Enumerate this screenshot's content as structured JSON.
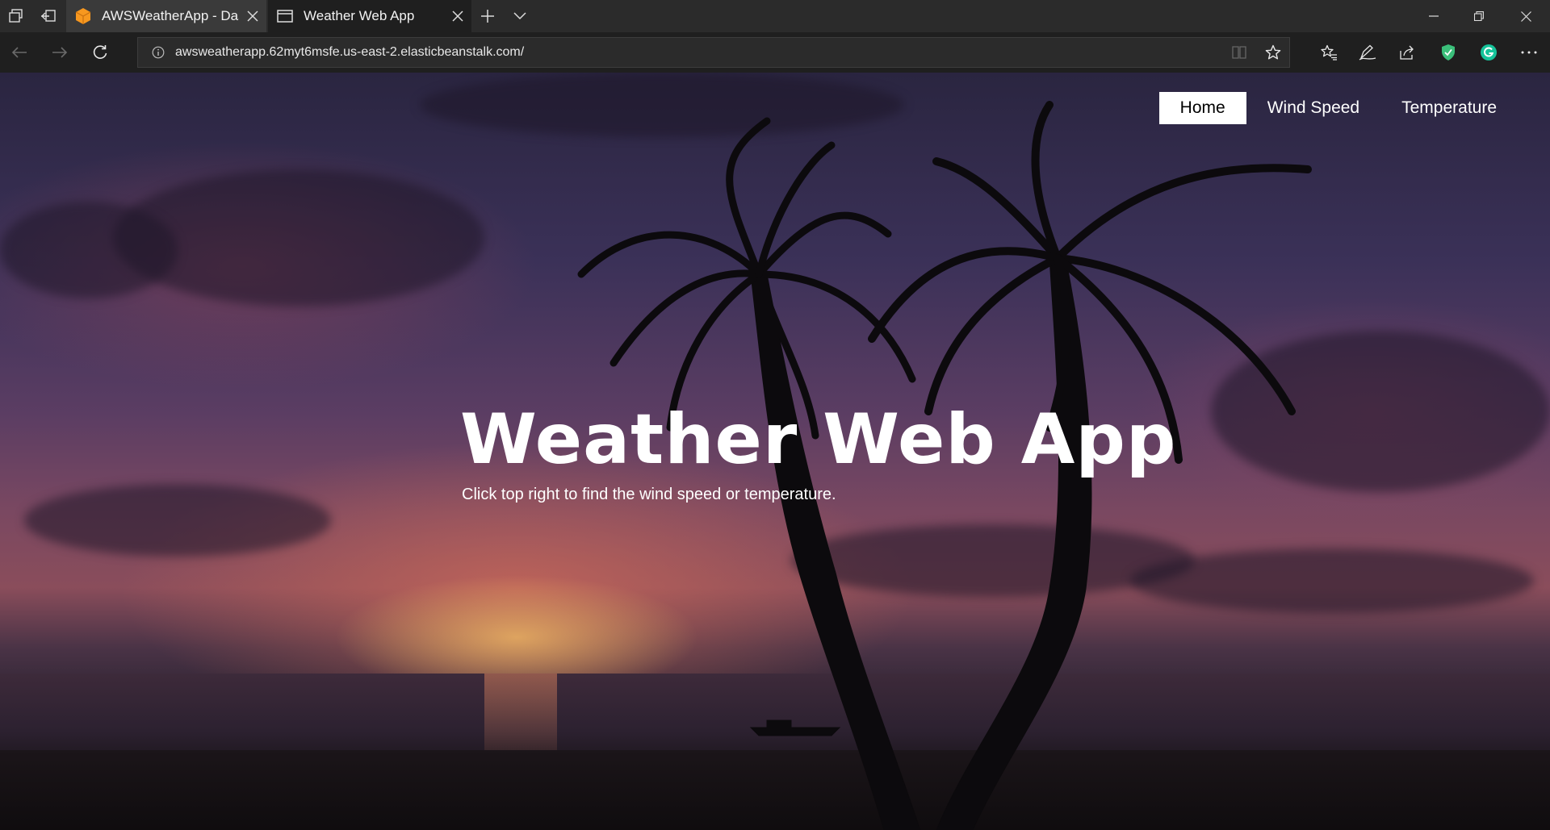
{
  "browser": {
    "tabs": [
      {
        "title": "AWSWeatherApp - Dasl",
        "active": false,
        "icon": "aws-cube-icon"
      },
      {
        "title": "Weather Web App",
        "active": true,
        "icon": "page-icon"
      }
    ],
    "address_url": "awsweatherapp.62myt6msfe.us-east-2.elasticbeanstalk.com/",
    "colors": {
      "tabbar": "#2b2b2b",
      "toolbar": "#1f1f1f",
      "aws_orange": "#f7981f",
      "shield_green": "#3bbf7a",
      "grammarly_green": "#15c39a"
    }
  },
  "site": {
    "nav": [
      {
        "label": "Home",
        "active": true
      },
      {
        "label": "Wind Speed",
        "active": false
      },
      {
        "label": "Temperature",
        "active": false
      }
    ],
    "title": "Weather Web App",
    "subtitle": "Click top right to find the wind speed or temperature."
  }
}
